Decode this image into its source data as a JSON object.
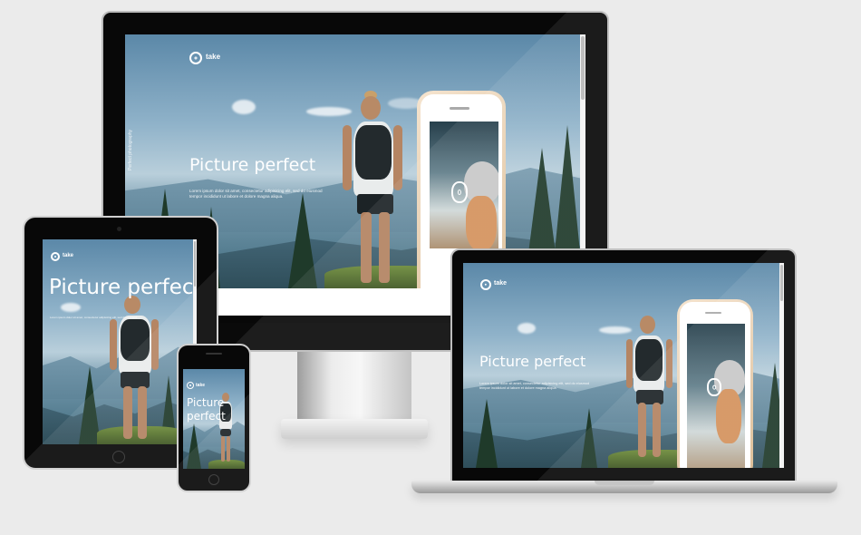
{
  "brand": {
    "name": "take"
  },
  "hero": {
    "headline": "Picture perfect",
    "headline_phone_line1": "Picture",
    "headline_phone_line2": "perfect",
    "body_line1": "Lorem ipsum dolor sit amet, consectetur adipisicing elit, sed do eiusmod",
    "body_line2": "tempor incididunt ut labore et dolore magna aliqua."
  },
  "side_label": "Perfect photography",
  "colors": {
    "background": "#ebebeb",
    "bezel": "#080808",
    "text": "#ffffff"
  },
  "icons": {
    "logo": "ring-logo-icon",
    "camera": "camera-icon",
    "home": "home-button-icon"
  }
}
